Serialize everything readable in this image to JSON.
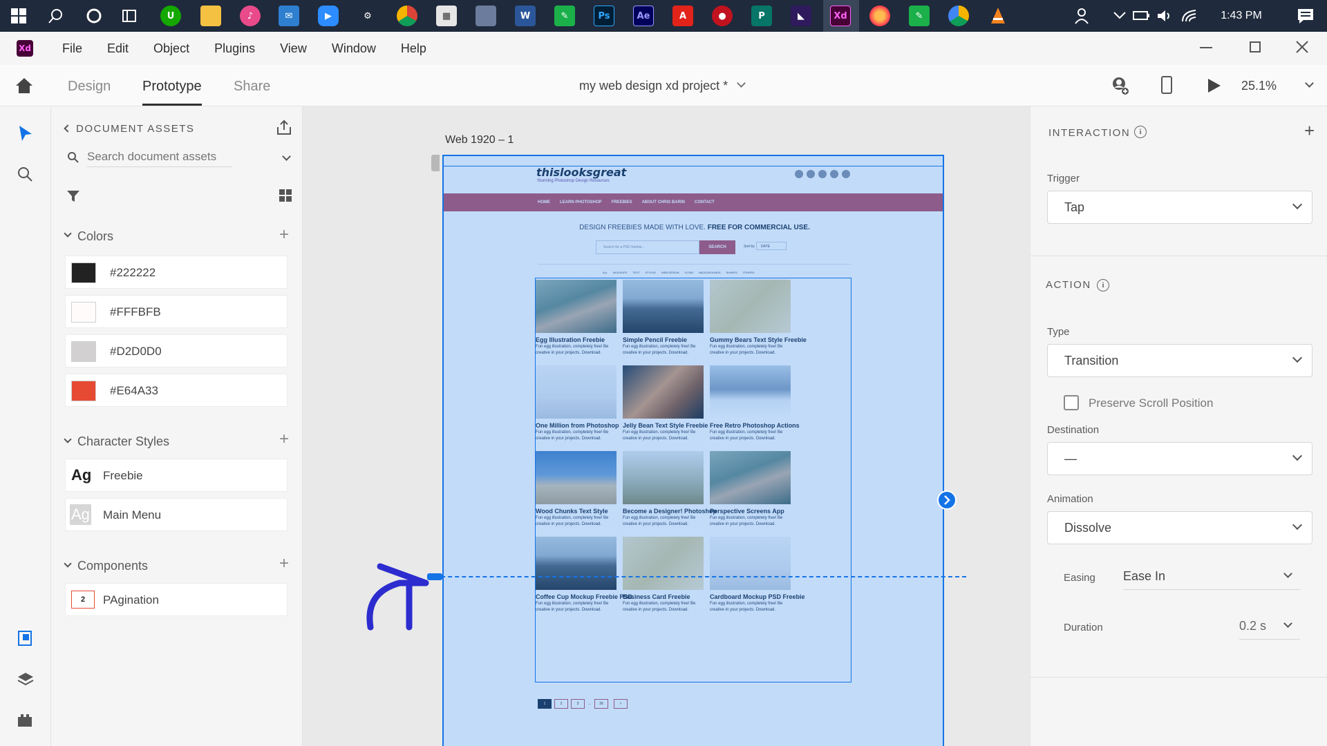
{
  "taskbar": {
    "icons": [
      "windows-start-icon",
      "search-icon",
      "cortana-icon",
      "task-view-icon",
      "upwork-icon",
      "file-explorer-icon",
      "itunes-icon",
      "mail-icon",
      "zoom-icon",
      "unknown-app-icon",
      "chrome-icon",
      "store-icon",
      "photos-icon",
      "word-icon",
      "app-icon",
      "photoshop-icon",
      "after-effects-icon",
      "acrobat-icon",
      "app-icon",
      "publisher-icon",
      "app-icon",
      "xd-icon",
      "firefox-icon",
      "app-icon",
      "chrome-canary-icon",
      "vlc-icon"
    ],
    "letters": {
      "word": "W",
      "photoshop": "Ps",
      "after_effects": "Ae",
      "publisher": "P",
      "xd": "Xd"
    },
    "time": "1:43 PM"
  },
  "app": {
    "logo": "Xd",
    "logo_color": "#470137",
    "accent": "#1473e6"
  },
  "menu": [
    "File",
    "Edit",
    "Object",
    "Plugins",
    "View",
    "Window",
    "Help"
  ],
  "toolbar": {
    "tabs": [
      "Design",
      "Prototype",
      "Share"
    ],
    "active_tab": "Prototype",
    "document_title": "my web design xd project *",
    "zoom": "25.1%"
  },
  "assets": {
    "title": "DOCUMENT ASSETS",
    "search_placeholder": "Search document assets",
    "colors_label": "Colors",
    "colors": [
      {
        "hex": "#222222",
        "label": "#222222"
      },
      {
        "hex": "#FFFBFB",
        "label": "#FFFBFB"
      },
      {
        "hex": "#D2D0D0",
        "label": "#D2D0D0"
      },
      {
        "hex": "#E64A33",
        "label": "#E64A33"
      }
    ],
    "character_styles_label": "Character Styles",
    "character_styles": [
      {
        "sample": "Ag",
        "name": "Freebie"
      },
      {
        "sample": "Ag",
        "name": "Main Menu"
      }
    ],
    "components_label": "Components",
    "components": [
      {
        "sample": "2",
        "name": "PAgination"
      }
    ]
  },
  "canvas": {
    "artboard_name": "Web 1920 – 1",
    "site": {
      "logo": "thislooksgreat",
      "tagline": "Stunning Photoshop Design Resources",
      "nav": [
        "HOME",
        "LEARN PHOTOSHOP",
        "FREEBIES",
        "ABOUT CHRIS BARIN",
        "CONTACT"
      ],
      "headline_light": "DESIGN FREEBIES MADE WITH LOVE.",
      "headline_bold": "FREE FOR COMMERCIAL USE.",
      "search_placeholder": "Search for a PSD freebie...",
      "search_button": "SEARCH",
      "sort_label": "Sort by",
      "sort_value": "DATE",
      "filters": [
        "ALL",
        "MOCKUPS",
        "TEXT",
        "STYLES",
        "WEB DESIGN",
        "ICONS",
        "BACKGROUNDS",
        "SHAPES",
        "OTHERS"
      ],
      "card_desc": "Fun egg illustration, completely free! Be creative in your projects. Download.",
      "cards": [
        {
          "title": "Egg Illustration Freebie",
          "img": "hand"
        },
        {
          "title": "Simple Pencil Freebie",
          "img": "road"
        },
        {
          "title": "Gummy Bears Text Style Freebie",
          "img": "texture"
        },
        {
          "title": "One Million from Photoshop",
          "img": "building"
        },
        {
          "title": "Jelly Bean Text Style Freebie",
          "img": "people"
        },
        {
          "title": "Free Retro Photoshop Actions",
          "img": "snow"
        },
        {
          "title": "Wood Chunks Text Style",
          "img": "beach"
        },
        {
          "title": "Become a Designer! Photoshop",
          "img": "field"
        },
        {
          "title": "Perspective Screens App",
          "img": "hand"
        },
        {
          "title": "Coffee Cup Mockup Freebie PSD",
          "img": "road"
        },
        {
          "title": "Business Card Freebie",
          "img": "texture"
        },
        {
          "title": "Cardboard Mockup PSD Freebie",
          "img": "building"
        }
      ],
      "pagination": [
        "1",
        "2",
        "3",
        "...",
        "26",
        "›"
      ]
    }
  },
  "interaction": {
    "title": "INTERACTION",
    "trigger_label": "Trigger",
    "trigger": "Tap",
    "action_title": "ACTION",
    "type_label": "Type",
    "type": "Transition",
    "preserve_scroll": "Preserve Scroll Position",
    "destination_label": "Destination",
    "destination": "—",
    "animation_label": "Animation",
    "animation": "Dissolve",
    "easing_label": "Easing",
    "easing": "Ease In",
    "duration_label": "Duration",
    "duration": "0.2 s"
  }
}
